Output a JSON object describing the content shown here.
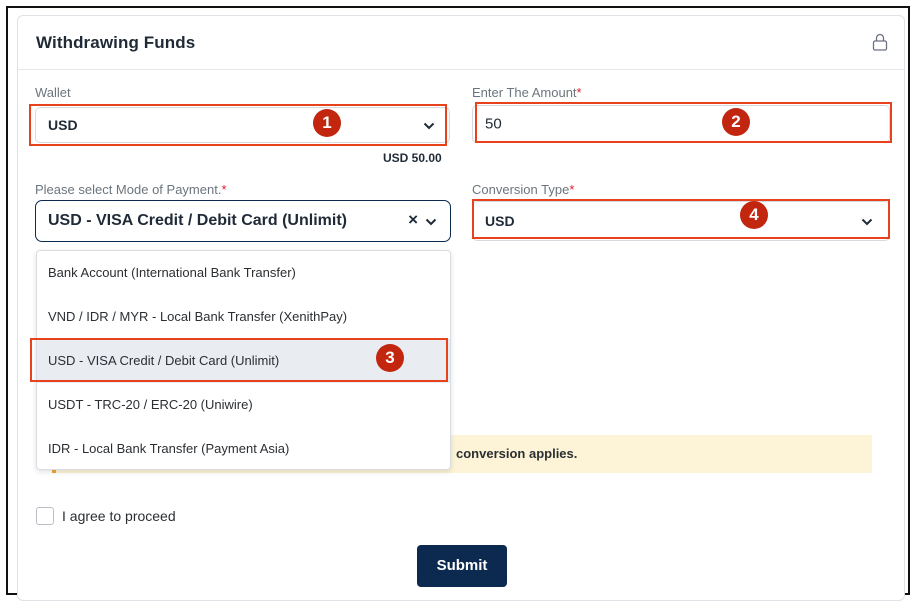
{
  "card": {
    "title": "Withdrawing Funds"
  },
  "wallet": {
    "label": "Wallet",
    "value": "USD",
    "balance": "USD 50.00"
  },
  "amount": {
    "label": "Enter The Amount",
    "required_mark": "*",
    "value": "50"
  },
  "payment": {
    "label": "Please select Mode of Payment.",
    "required_mark": "*",
    "value": "USD - VISA Credit / Debit Card (Unlimit)",
    "clear_glyph": "×",
    "options": [
      "Bank Account (International Bank Transfer)",
      "VND / IDR / MYR - Local Bank Transfer (XenithPay)",
      "USD - VISA Credit / Debit Card (Unlimit)",
      "USDT - TRC-20 / ERC-20 (Uniwire)",
      "IDR - Local Bank Transfer (Payment Asia)"
    ],
    "selected_option": "USD - VISA Credit / Debit Card (Unlimit)"
  },
  "conversion": {
    "label": "Conversion Type",
    "required_mark": "*",
    "value": "USD"
  },
  "alert": {
    "text": "conversion applies."
  },
  "agree": {
    "label": "I agree to proceed",
    "checked": false
  },
  "submit": {
    "label": "Submit"
  },
  "annotations": {
    "badges": [
      "1",
      "2",
      "3",
      "4"
    ]
  },
  "colors": {
    "primary": "#0c2a50",
    "marker": "#e8411e",
    "badge": "#c2260f",
    "alert_bg": "#fdf4d7",
    "alert_border": "#f0a830",
    "required": "#e11d2e"
  },
  "icons": {
    "lock": "lock-icon",
    "chevron": "chevron-down-icon",
    "clear": "clear-icon"
  }
}
